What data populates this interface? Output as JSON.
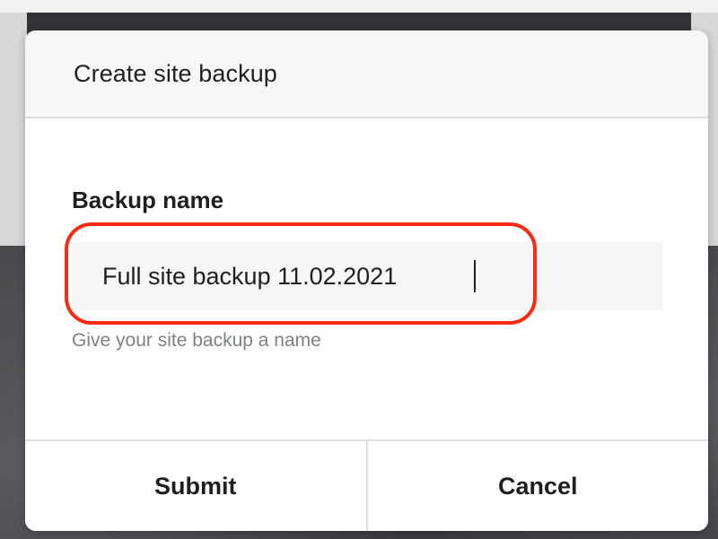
{
  "dialog": {
    "title": "Create site backup",
    "field_label": "Backup name",
    "input_value": "Full site backup 11.02.2021",
    "helper_text": "Give your site backup a name",
    "submit_label": "Submit",
    "cancel_label": "Cancel"
  },
  "colors": {
    "highlight": "#ff2a14",
    "input_background": "#f5f6f8",
    "header_background": "#f6f7f8"
  }
}
